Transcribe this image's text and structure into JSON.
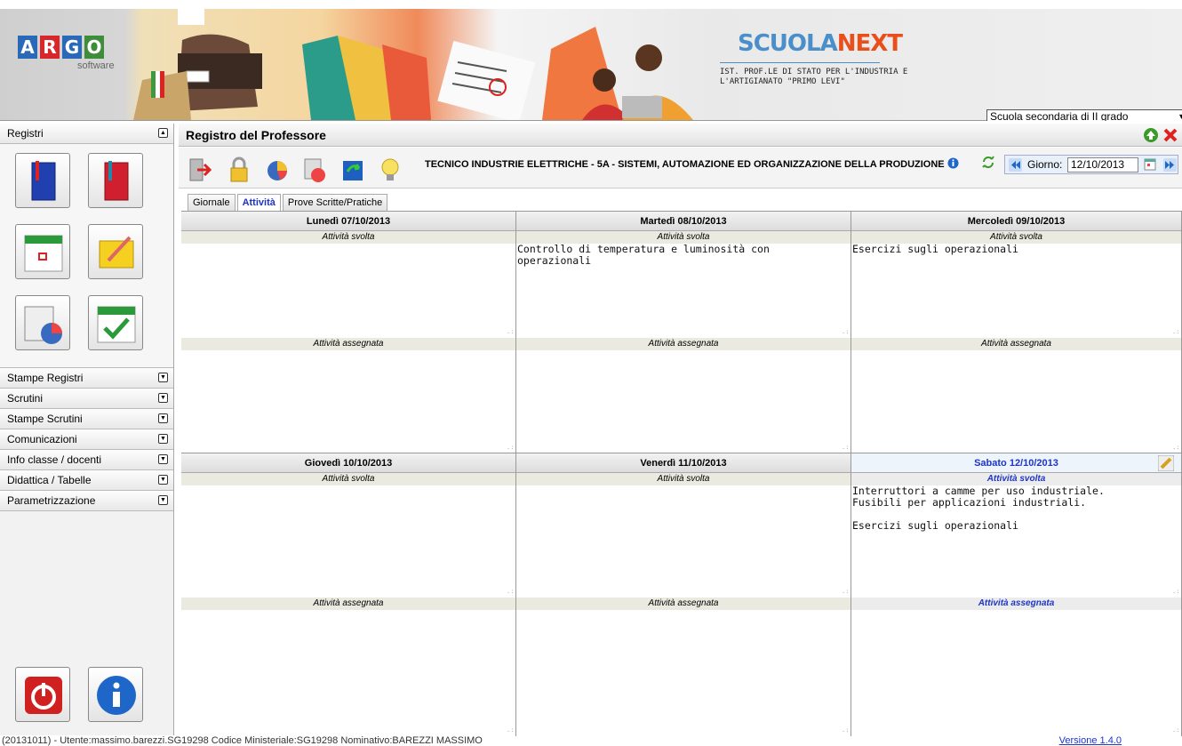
{
  "header": {
    "logo": {
      "letters": [
        "A",
        "R",
        "G",
        "O"
      ],
      "colors": [
        "#2a69b8",
        "#d9262b",
        "#2a69b8",
        "#3d8d3a"
      ],
      "sub": "software"
    },
    "brand": {
      "part1": "SCUOLA",
      "part2": "NEXT"
    },
    "school": "IST. PROF.LE DI STATO PER L'INDUSTRIA E L'ARTIGIANATO \"PRIMO LEVI\"",
    "grade_select": "Scuola secondaria di II grado"
  },
  "sidebar": {
    "registri_label": "Registri",
    "sections": [
      "Stampe Registri",
      "Scrutini",
      "Stampe Scrutini",
      "Comunicazioni",
      "Info classe / docenti",
      "Didattica / Tabelle",
      "Parametrizzazione"
    ]
  },
  "main": {
    "title": "Registro del Professore",
    "class_title": "TECNICO INDUSTRIE ELETTRICHE - 5A - SISTEMI, AUTOMAZIONE ED ORGANIZZAZIONE DELLA PRODUZIONE",
    "date_label": "Giorno:",
    "date_value": "12/10/2013",
    "tabs": [
      "Giornale",
      "Attività",
      "Prove Scritte/Pratiche"
    ]
  },
  "days": [
    {
      "title": "Lunedì 07/10/2013",
      "svolta_label": "Attività svolta",
      "svolta": "",
      "assegnata_label": "Attività assegnata",
      "assegnata": ""
    },
    {
      "title": "Martedì 08/10/2013",
      "svolta_label": "Attività svolta",
      "svolta": "Controllo di temperatura e luminosità con\noperazionali",
      "assegnata_label": "Attività assegnata",
      "assegnata": ""
    },
    {
      "title": "Mercoledì 09/10/2013",
      "svolta_label": "Attività svolta",
      "svolta": "Esercizi sugli operazionali",
      "assegnata_label": "Attività assegnata",
      "assegnata": ""
    },
    {
      "title": "Giovedì 10/10/2013",
      "svolta_label": "Attività svolta",
      "svolta": "",
      "assegnata_label": "Attività assegnata",
      "assegnata": ""
    },
    {
      "title": "Venerdì 11/10/2013",
      "svolta_label": "Attività svolta",
      "svolta": "",
      "assegnata_label": "Attività assegnata",
      "assegnata": ""
    },
    {
      "title": "Sabato 12/10/2013",
      "svolta_label": "Attività svolta",
      "svolta": "Interruttori a camme per uso industriale.\nFusibili per applicazioni industriali.\n\nEsercizi sugli operazionali",
      "assegnata_label": "Attività assegnata",
      "assegnata": ""
    }
  ],
  "status": {
    "text": "(20131011) - Utente:massimo.barezzi.SG19298 Codice Ministeriale:SG19298 Nominativo:BAREZZI MASSIMO",
    "version": "Versione 1.4.0"
  }
}
